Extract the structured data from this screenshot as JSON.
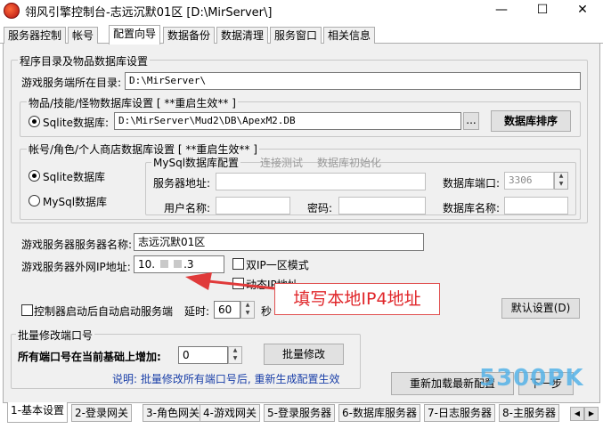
{
  "window": {
    "title": "翎风引擎控制台-志远沉默01区 [D:\\MirServer\\]",
    "minimize": "—",
    "maximize": "☐",
    "close": "✕"
  },
  "top_tabs": [
    "服务器控制",
    "帐号",
    "配置向导",
    "数据备份",
    "数据清理",
    "服务窗口",
    "相关信息"
  ],
  "active_top_tab": "配置向导",
  "group_paths": {
    "title": "程序目录及物品数据库设置",
    "game_dir_label": "游戏服务端所在目录:",
    "game_dir_value": "D:\\MirServer\\"
  },
  "group_itemdb": {
    "title": "物品/技能/怪物数据库设置 [ **重启生效** ]",
    "sqlite_label": "Sqlite数据库:",
    "sqlite_path": "D:\\MirServer\\Mud2\\DB\\ApexM2.DB",
    "browse_label": "...",
    "sort_button": "数据库排序"
  },
  "group_accountdb": {
    "title": "帐号/角色/个人商店数据库设置  [ **重启生效** ]",
    "radio_sqlite": "Sqlite数据库",
    "radio_mysql": "MySql数据库",
    "mysql_group_title": "MySql数据库配置",
    "link_test": "连接测试",
    "link_init": "数据库初始化",
    "server_addr_label": "服务器地址:",
    "db_port_label": "数据库端口:",
    "db_port_value": "3306",
    "user_label": "用户名称:",
    "password_label": "密码:",
    "db_name_label": "数据库名称:"
  },
  "server": {
    "name_label": "游戏服务器服务器名称:",
    "name_value": "志远沉默01区",
    "ip_label": "游戏服务器外网IP地址:",
    "ip_value_prefix": "10.",
    "ip_value_suffix": ".3",
    "dual_ip_label": "双IP一区模式",
    "dynamic_ip_label": "动态IP地址",
    "autostart_label": "控制器启动后自动启动服务端",
    "delay_label": "延时:",
    "delay_value": "60",
    "seconds_label": "秒",
    "default_button": "默认设置(D)"
  },
  "ports": {
    "title": "批量修改端口号",
    "add_label": "所有端口号在当前基础上增加:",
    "add_value": "0",
    "batch_button": "批量修改",
    "note": "说明: 批量修改所有端口号后, 重新生成配置生效"
  },
  "reload_button": "重新加载最新配置",
  "next_button": "下一步",
  "annotation": "填写本地IP4地址",
  "watermark": "5300PK",
  "bottom_tabs": [
    "1-基本设置",
    "2-登录网关",
    "3-角色网关",
    "4-游戏网关",
    "5-登录服务器",
    "6-数据库服务器",
    "7-日志服务器",
    "8-主服务器"
  ],
  "active_bottom_tab": "1-基本设置",
  "colors": {
    "annotation_red": "#e0262a",
    "note_blue": "#1a3fa8",
    "watermark_blue": "#56b3e8"
  }
}
